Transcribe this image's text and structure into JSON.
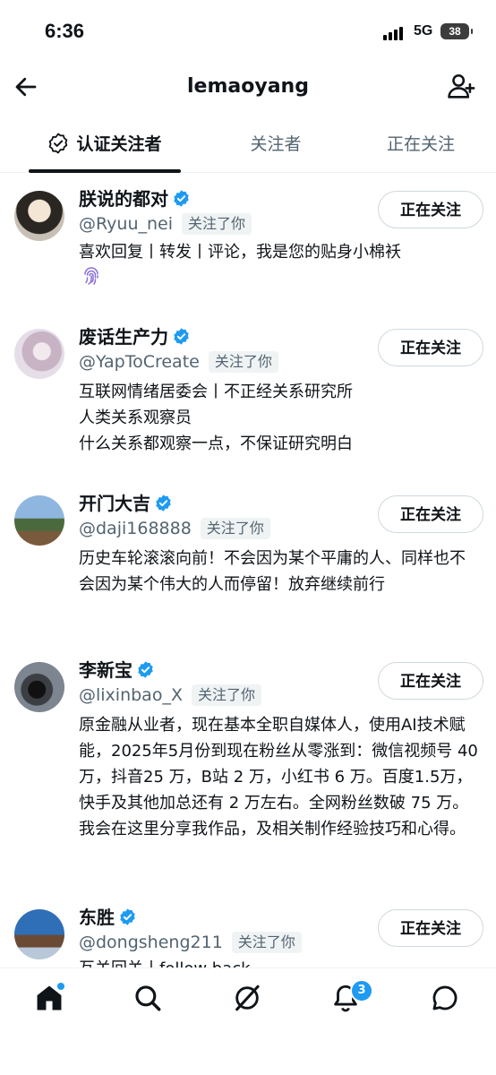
{
  "status_bar": {
    "time": "6:36",
    "network": "5G",
    "battery": "38"
  },
  "header": {
    "title": "lemaoyang",
    "back_icon": "arrow-left-icon",
    "add_icon": "add-user-icon"
  },
  "tabs": [
    {
      "label": "认证关注者",
      "active": true
    },
    {
      "label": "关注者",
      "active": false
    },
    {
      "label": "正在关注",
      "active": false
    }
  ],
  "users": [
    {
      "name": "朕说的都对",
      "handle": "@Ryuu_nei",
      "badge": "关注了你",
      "button": "正在关注",
      "bio": "喜欢回复丨转发丨评论，我是您的贴身小棉袄",
      "bio_icon": "fingerprint-icon"
    },
    {
      "name": "废话生产力",
      "handle": "@YapToCreate",
      "badge": "关注了你",
      "button": "正在关注",
      "bio": "互联网情绪居委会丨不正经关系研究所\n人类关系观察员\n什么关系都观察一点，不保证研究明白"
    },
    {
      "name": "开门大吉",
      "handle": "@daji168888",
      "badge": "关注了你",
      "button": "正在关注",
      "bio": "历史车轮滚滚向前！不会因为某个平庸的人、同样也不会因为某个伟大的人而停留！放弃继续前行"
    },
    {
      "name": "李新宝",
      "handle": "@lixinbao_X",
      "badge": "关注了你",
      "button": "正在关注",
      "bio": "原金融从业者，现在基本全职自媒体人，使用AI技术赋能，2025年5月份到现在粉丝从零涨到：微信视频号 40 万，抖音25 万，B站 2 万，小红书 6 万。百度1.5万，快手及其他加总还有 2 万左右。全网粉丝数破 75 万。 我会在这里分享我作品，及相关制作经验技巧和心得。"
    },
    {
      "name": "东胜",
      "handle": "@dongsheng211",
      "badge": "关注了你",
      "button": "正在关注",
      "bio": "互关回关丨follow back"
    }
  ],
  "bottom_nav": {
    "items": [
      "home-icon",
      "search-icon",
      "grok-icon",
      "notifications-icon",
      "messages-icon"
    ],
    "notification_count": "3"
  },
  "colors": {
    "accent": "#1d9bf0",
    "text": "#0f1419",
    "muted": "#536471"
  }
}
